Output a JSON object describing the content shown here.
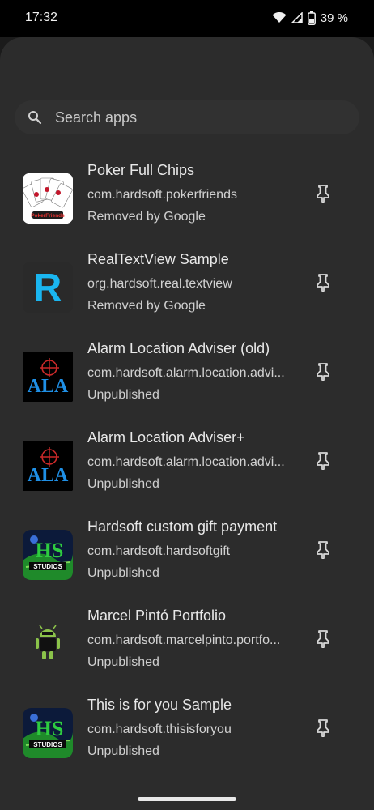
{
  "status_bar": {
    "time": "17:32",
    "battery": "39 %",
    "icons": [
      "wifi-icon",
      "signal-icon",
      "battery-icon"
    ]
  },
  "search": {
    "placeholder": "Search apps",
    "icon": "search-icon"
  },
  "apps": [
    {
      "title": "Poker Full Chips",
      "package": "com.hardsoft.pokerfriends",
      "status": "Removed by Google",
      "icon": "poker-cards-icon"
    },
    {
      "title": "RealTextView Sample",
      "package": "org.hardsoft.real.textview",
      "status": "Removed by Google",
      "icon": "realtextview-r-icon"
    },
    {
      "title": "Alarm Location Adviser (old)",
      "package": "com.hardsoft.alarm.location.advi...",
      "status": "Unpublished",
      "icon": "ala-icon"
    },
    {
      "title": "Alarm Location Adviser+",
      "package": "com.hardsoft.alarm.location.advi...",
      "status": "Unpublished",
      "icon": "ala-plus-icon"
    },
    {
      "title": "Hardsoft custom gift payment",
      "package": "com.hardsoft.hardsoftgift",
      "status": "Unpublished",
      "icon": "hs-studios-icon"
    },
    {
      "title": "Marcel Pintó Portfolio",
      "package": "com.hardsoft.marcelpinto.portfo...",
      "status": "Unpublished",
      "icon": "android-robot-icon"
    },
    {
      "title": "This is for you Sample",
      "package": "com.hardsoft.thisisforyou",
      "status": "Unpublished",
      "icon": "hs-studios-icon"
    }
  ],
  "pin_icon": "pin-icon",
  "logo_text": {
    "poker": "PokerFriends",
    "realtextview": "R",
    "ala": "ALA",
    "hs": "HS",
    "studios": "STUDIOS"
  }
}
